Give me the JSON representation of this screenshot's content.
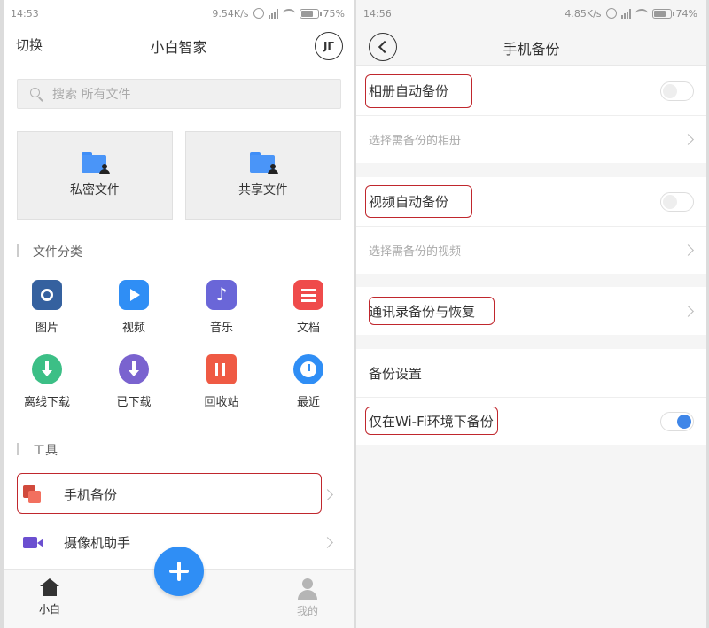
{
  "left": {
    "status": {
      "time": "14:53",
      "speed": "9.54K/s",
      "battery": "75%",
      "battery_level": 0.75
    },
    "header": {
      "switch_label": "切换",
      "title": "小白智家",
      "avatar_text": "JΓ"
    },
    "search": {
      "placeholder": "搜索 所有文件"
    },
    "cards": [
      {
        "label": "私密文件",
        "icon": "private-folder-icon"
      },
      {
        "label": "共享文件",
        "icon": "shared-folder-icon"
      }
    ],
    "categories_title": "文件分类",
    "categories": [
      {
        "label": "图片",
        "icon": "camera-icon"
      },
      {
        "label": "视频",
        "icon": "video-icon"
      },
      {
        "label": "音乐",
        "icon": "music-icon"
      },
      {
        "label": "文档",
        "icon": "document-icon"
      },
      {
        "label": "离线下载",
        "icon": "offline-download-icon"
      },
      {
        "label": "已下载",
        "icon": "downloaded-icon"
      },
      {
        "label": "回收站",
        "icon": "trash-icon"
      },
      {
        "label": "最近",
        "icon": "recent-clock-icon"
      }
    ],
    "tools_title": "工具",
    "tools": [
      {
        "label": "手机备份",
        "icon": "phone-backup-icon"
      },
      {
        "label": "摄像机助手",
        "icon": "camcorder-icon"
      }
    ],
    "tabbar": {
      "home_label": "小白",
      "mine_label": "我的"
    }
  },
  "right": {
    "status": {
      "time": "14:56",
      "speed": "4.85K/s",
      "battery": "74%",
      "battery_level": 0.74
    },
    "header": {
      "title": "手机备份"
    },
    "album_backup": {
      "label": "相册自动备份",
      "sub": "选择需备份的相册",
      "enabled": false
    },
    "video_backup": {
      "label": "视频自动备份",
      "sub": "选择需备份的视频",
      "enabled": false
    },
    "contacts": {
      "label": "通讯录备份与恢复"
    },
    "settings_title": "备份设置",
    "wifi_only": {
      "label": "仅在Wi-Fi环境下备份",
      "enabled": true
    }
  },
  "colors": {
    "accent": "#2f8ef5",
    "annotation": "#c0272d",
    "toggle_on": "#3f86e8"
  }
}
